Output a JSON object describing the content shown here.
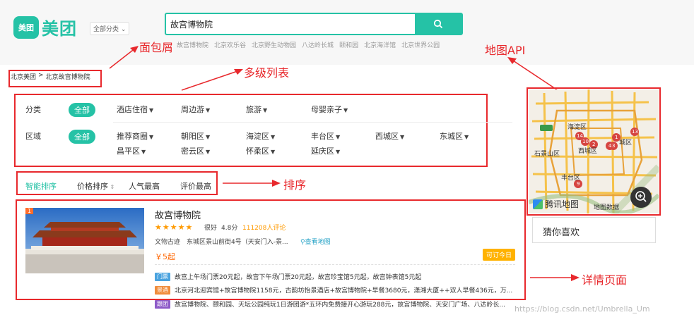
{
  "header": {
    "logo_badge": "美团",
    "logo_text": "美团",
    "category_select": "全部分类",
    "search_value": "故宫博物院",
    "hot_words": [
      "故宫博物院",
      "北京欢乐谷",
      "北京野生动物园",
      "八达岭长城",
      "颐和园",
      "北京海洋馆",
      "北京世界公园"
    ]
  },
  "breadcrumb": {
    "items": [
      "北京美团",
      ">",
      "北京故宫博物院"
    ]
  },
  "annotations": {
    "breadcrumb": "面包屑",
    "multilevel": "多级列表",
    "map_api": "地图API",
    "sort": "排序",
    "detail": "详情页面"
  },
  "filters": {
    "category": {
      "label": "分类",
      "all": "全部",
      "options": [
        "酒店住宿",
        "周边游",
        "旅游",
        "母婴亲子"
      ]
    },
    "region": {
      "label": "区域",
      "all": "全部",
      "options": [
        "推荐商圈",
        "朝阳区",
        "海淀区",
        "丰台区",
        "西城区",
        "东城区",
        "昌平区",
        "密云区",
        "怀柔区",
        "延庆区"
      ]
    }
  },
  "sort": {
    "options": [
      "智能排序",
      "价格排序",
      "人气最高",
      "评价最高"
    ],
    "active": "智能排序"
  },
  "map": {
    "district_labels": [
      "海淀区",
      "西城区",
      "石景山区",
      "丰台区",
      "城区"
    ],
    "markers": [
      "14",
      "10",
      "2",
      "1",
      "3",
      "4",
      "13",
      "9"
    ],
    "brand": "腾讯地图",
    "data_label": "地图数据"
  },
  "guess_you_like": "猜你喜欢",
  "listing": {
    "rank": "1",
    "name": "故宫博物院",
    "stars": "★★★★★",
    "rating_word": "很好",
    "score": "4.8分",
    "reviews": "111208人评论",
    "category": "文物古迹",
    "address": "东城区景山前街4号（天安门入-景...",
    "map_link": "查看地图",
    "price": "￥5起",
    "book_label": "可订今日",
    "deals": [
      {
        "tag": "门票",
        "color": "#4aa3df",
        "text": "故宫上午场门票20元起，故宫下午场门票20元起，故宫珍宝馆5元起，故宫钟表馆5元起"
      },
      {
        "tag": "景酒",
        "color": "#f08c3b",
        "text": "北京河北迎宾馆+故宫博物院1158元，古韵坊怡景酒店+故宫博物院+早餐3680元，潇湘大厦++双人早餐436元，万..."
      },
      {
        "tag": "跟团",
        "color": "#8e5bc8",
        "text": "故宫博物院、颐和园、天坛公园纯玩1日游团游*五环内免费接开心游玩288元，故宫博物院、天安门广场、八达岭长..."
      }
    ]
  },
  "watermark": "https://blog.csdn.net/Umbrella_Um",
  "colors": {
    "accent": "#25c2a6",
    "annotation": "#e8292d",
    "star": "#ff9a00",
    "price": "#ff6600"
  }
}
